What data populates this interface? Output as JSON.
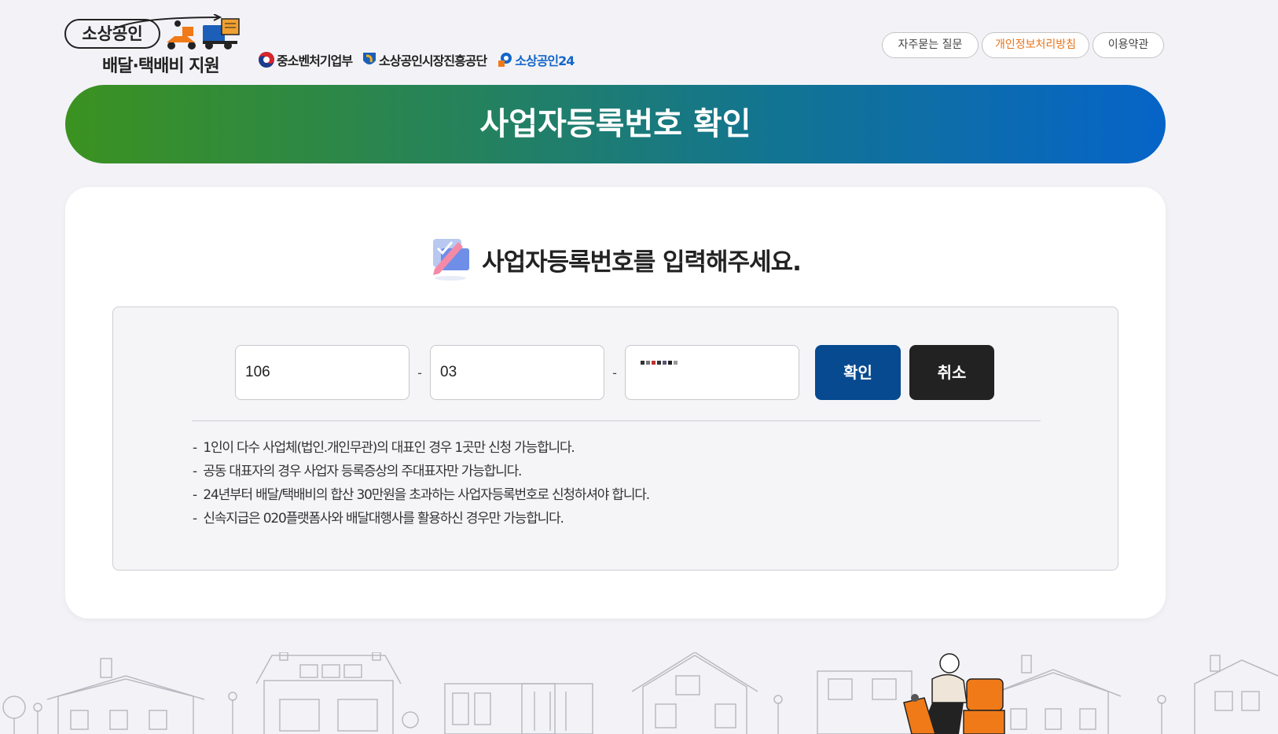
{
  "header": {
    "logo_title": "소상공인",
    "logo_subtitle": "배달·택배비 지원",
    "agencies": [
      "중소벤처기업부",
      "소상공인시장진흥공단",
      "소상공인24"
    ],
    "links": [
      {
        "label": "자주묻는 질문"
      },
      {
        "label": "개인정보처리방침"
      },
      {
        "label": "이용약관"
      }
    ]
  },
  "banner": {
    "title": "사업자등록번호 확인"
  },
  "form": {
    "heading": "사업자등록번호를 입력해주세요.",
    "field1": "106",
    "field2": "03",
    "separator": "-",
    "confirm_label": "확인",
    "cancel_label": "취소"
  },
  "notes": [
    "1인이 다수 사업체(법인.개인무관)의 대표인 경우 1곳만 신청 가능합니다.",
    "공동 대표자의 경우 사업자 등록증상의 주대표자만 가능합니다.",
    "24년부터 배달/택배비의 합산 30만원을 초과하는 사업자등록번호로 신청하셔야 합니다.",
    "신속지급은 020플랫폼사와 배달대행사를 활용하신 경우만 가능합니다."
  ],
  "colors": {
    "background": "#f3f3f7",
    "banner_start": "#3b9220",
    "banner_end": "#0664c8",
    "confirm": "#074a90",
    "cancel": "#222222",
    "privacy_link": "#e8741c",
    "agency_blue": "#1466c8"
  },
  "icons": [
    "arrow-icon",
    "delivery-scooter-icon",
    "korea-emblem-icon",
    "semas-icon",
    "sbiz24-icon",
    "pencil-check-icon"
  ]
}
